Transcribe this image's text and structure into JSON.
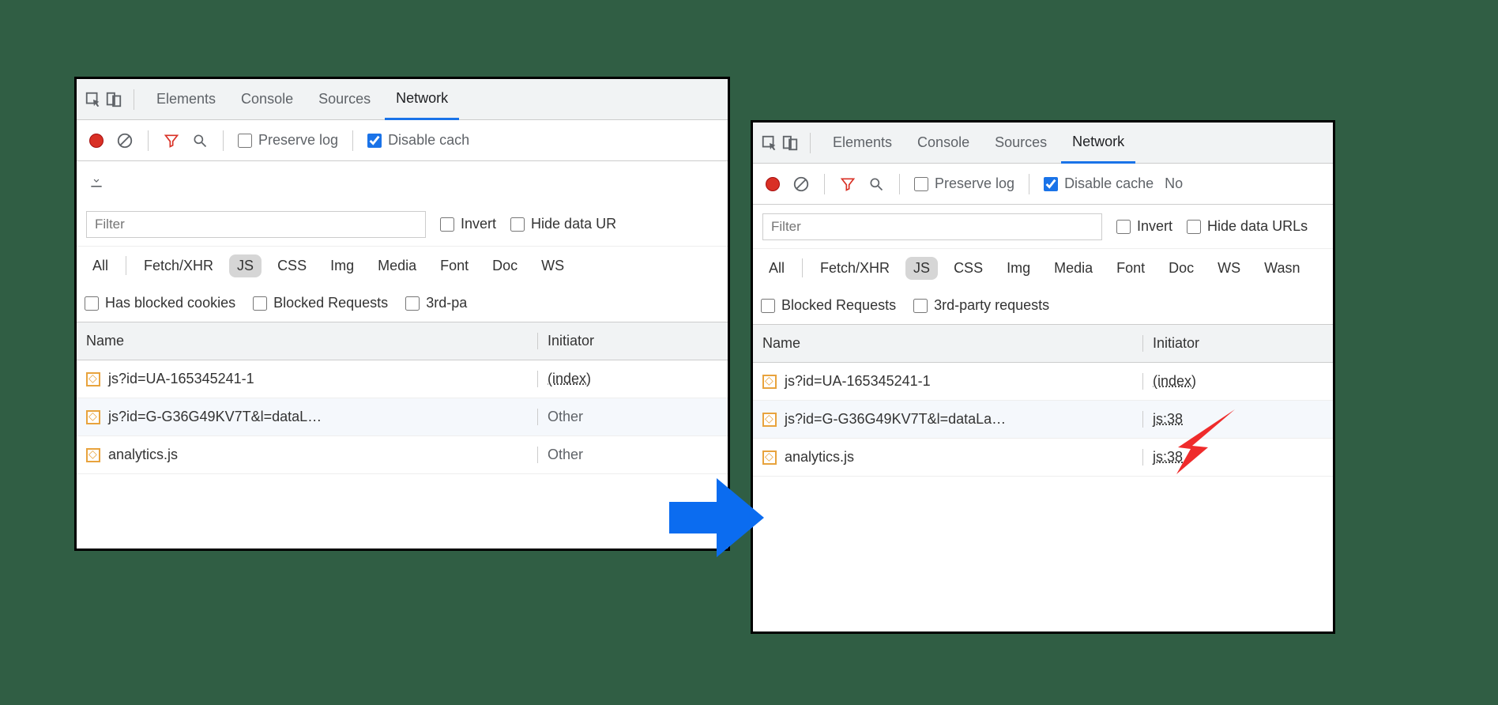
{
  "tabs": {
    "elements": "Elements",
    "console": "Console",
    "sources": "Sources",
    "network": "Network"
  },
  "toolbar": {
    "preserve": "Preserve log",
    "disable": "Disable cache",
    "disable_short": "Disable cach",
    "no": "No"
  },
  "filter": {
    "placeholder": "Filter",
    "invert": "Invert",
    "hide_left": "Hide data UR",
    "hide_right": "Hide data URLs"
  },
  "types": {
    "all": "All",
    "fetchxhr": "Fetch/XHR",
    "js": "JS",
    "css": "CSS",
    "img": "Img",
    "media": "Media",
    "font": "Font",
    "doc": "Doc",
    "ws": "WS",
    "wasm": "Wasn"
  },
  "checks": {
    "hasblocked": "Has blocked cookies",
    "blockedreq": "Blocked Requests",
    "third_left": "3rd-pa",
    "third_right": "3rd-party requests"
  },
  "thead": {
    "name": "Name",
    "initiator": "Initiator"
  },
  "rows_left": [
    {
      "name": "js?id=UA-165345241-1",
      "init": "(index)",
      "link": true
    },
    {
      "name": "js?id=G-G36G49KV7T&l=dataL…",
      "init": "Other",
      "link": false
    },
    {
      "name": "analytics.js",
      "init": "Other",
      "link": false
    }
  ],
  "rows_right": [
    {
      "name": "js?id=UA-165345241-1",
      "init": "(index)",
      "link": true
    },
    {
      "name": "js?id=G-G36G49KV7T&l=dataLa…",
      "init": "js:38",
      "link": true
    },
    {
      "name": "analytics.js",
      "init": "js:38",
      "link": true
    }
  ]
}
